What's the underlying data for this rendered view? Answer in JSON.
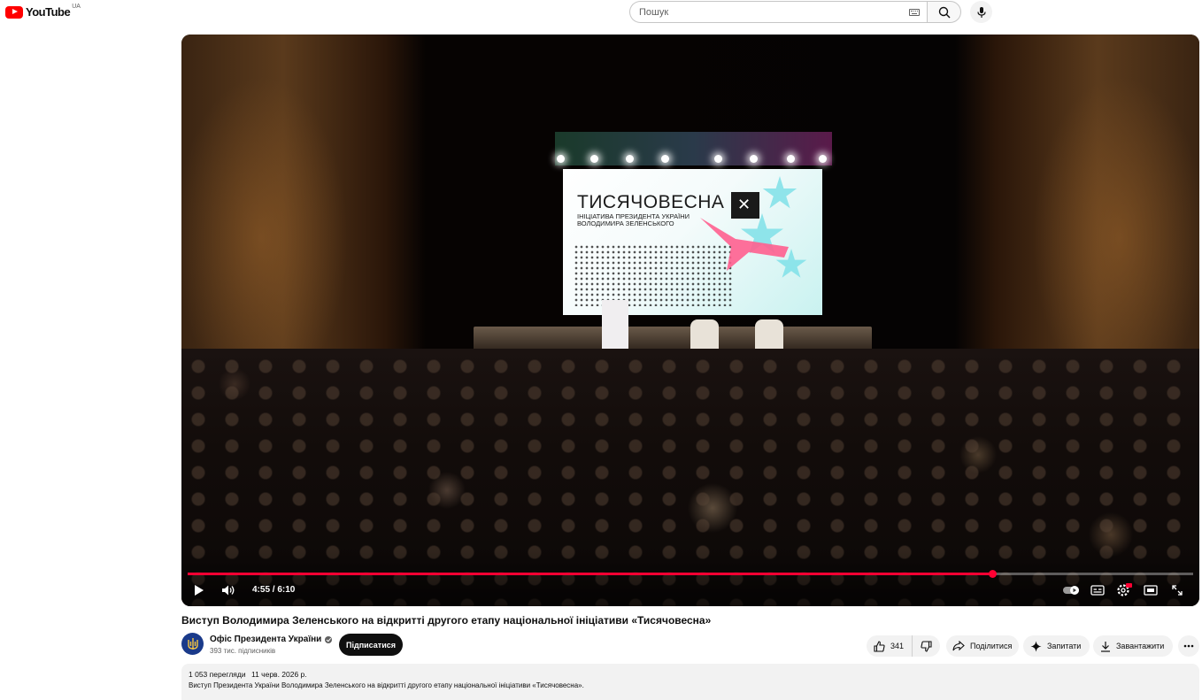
{
  "header": {
    "logo_text": "YouTube",
    "region": "UA",
    "search_placeholder": "Пошук"
  },
  "player": {
    "current_time": "4:55",
    "duration": "6:10",
    "time_display": "4:55 / 6:10",
    "progress_fraction": 0.8,
    "slide": {
      "title": "ТИСЯЧОВЕСНА",
      "subtitle": "ІНІЦІАТИВА ПРЕЗИДЕНТА УКРАЇНИ ВОЛОДИМИРА ЗЕЛЕНСЬКОГО"
    }
  },
  "video": {
    "title": "Виступ Володимира Зеленського на відкритті другого етапу національної ініціативи «Тисячовесна»"
  },
  "channel": {
    "name": "Офіс Президента України",
    "subscribers": "393 тис. підписників",
    "subscribe_label": "Підписатися"
  },
  "actions": {
    "like_count": "341",
    "share_label": "Поділитися",
    "ask_label": "Запитати",
    "download_label": "Завантажити"
  },
  "description": {
    "views": "1 053 перегляди",
    "date": "11 черв. 2026 р.",
    "text": "Виступ Президента України Володимира Зеленського на відкритті другого етапу національної ініціативи «Тисячовесна»."
  },
  "colors": {
    "brand_red": "#ff0000",
    "progress_red": "#ff0033",
    "subscribe_bg": "#0f0f0f",
    "pill_bg": "#f2f2f2"
  },
  "icons": [
    "youtube-logo-icon",
    "keyboard-icon",
    "search-icon",
    "mic-icon",
    "play-icon",
    "volume-icon",
    "autoplay-toggle-icon",
    "subtitles-icon",
    "settings-icon",
    "miniplayer-icon",
    "fullscreen-icon",
    "verified-icon",
    "like-icon",
    "dislike-icon",
    "share-icon",
    "sparkle-icon",
    "download-icon",
    "more-icon"
  ]
}
